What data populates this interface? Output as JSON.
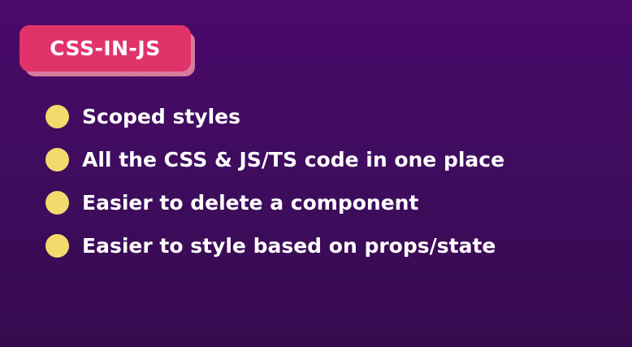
{
  "slide": {
    "title": "CSS-IN-JS",
    "bullets": [
      "Scoped styles",
      "All the CSS & JS/TS code in one place",
      "Easier to delete a component",
      "Easier to style based on props/state"
    ]
  },
  "colors": {
    "background": "#4a0a6a",
    "title_badge": "#e0336a",
    "title_badge_shadow": "#d97a9e",
    "bullet_dot": "#f4da6c",
    "text": "#ffffff"
  }
}
